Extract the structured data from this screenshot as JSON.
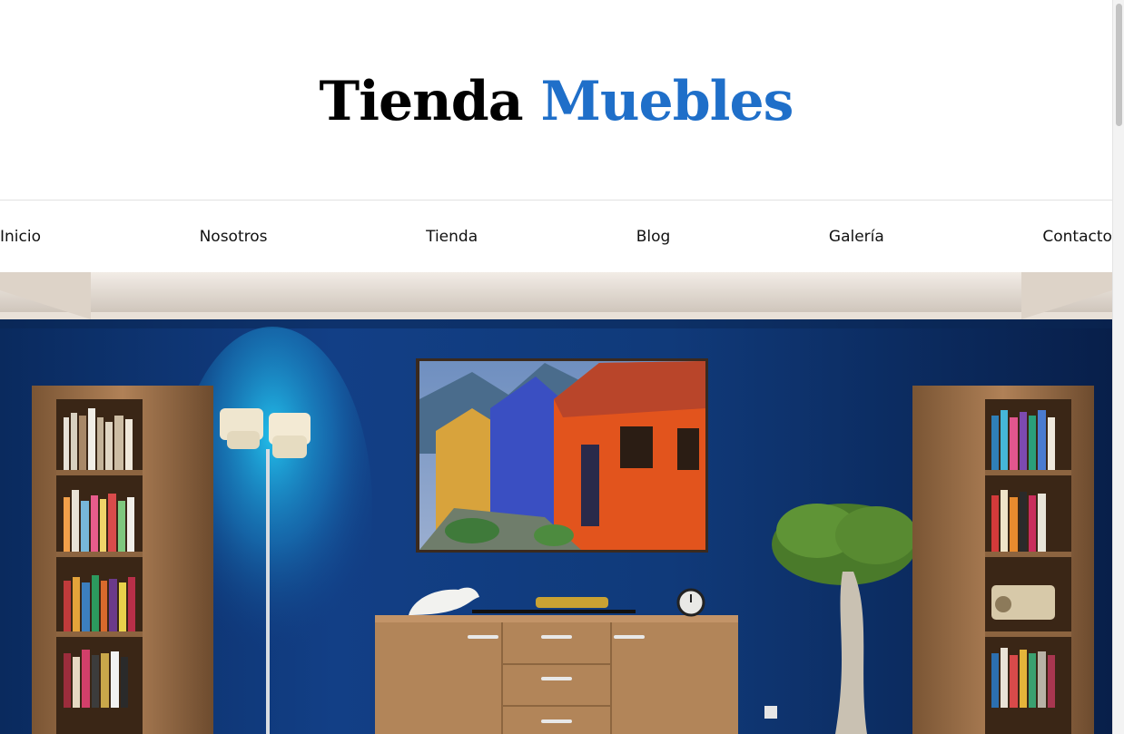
{
  "header": {
    "logo_part1": "Tienda",
    "logo_part2": "Muebles",
    "accent_color": "#1f6fc9"
  },
  "nav": {
    "items": [
      {
        "label": "Inicio"
      },
      {
        "label": "Nosotros"
      },
      {
        "label": "Tienda"
      },
      {
        "label": "Blog"
      },
      {
        "label": "Galería"
      },
      {
        "label": "Contacto"
      }
    ]
  },
  "hero": {
    "image": "living-room-blue-wall-photo",
    "wall_color": "#0f3a7c"
  }
}
